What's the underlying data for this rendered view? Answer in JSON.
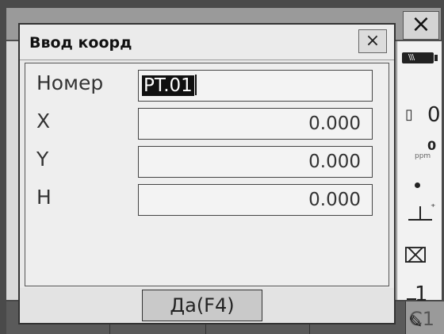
{
  "background": {
    "close_glyph": "×",
    "bottom_right_label": "C1"
  },
  "status": {
    "battery_icon": "battery-icon",
    "prism_constant": "0",
    "ppm_value": "0",
    "ppm_unit": "ppm",
    "level_value": "1"
  },
  "dialog": {
    "title": "Ввод коорд",
    "close_glyph": "×",
    "rows": [
      {
        "label": "Номер",
        "value": "PT.01"
      },
      {
        "label": "X",
        "value": "0.000"
      },
      {
        "label": "Y",
        "value": "0.000"
      },
      {
        "label": "H",
        "value": "0.000"
      }
    ],
    "ok_label": "Да(F4)"
  }
}
